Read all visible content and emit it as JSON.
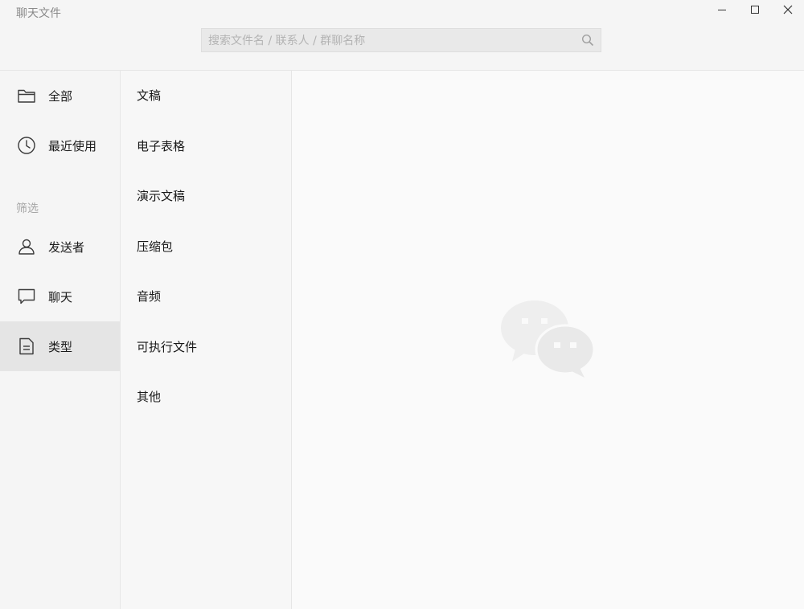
{
  "window": {
    "title": "聊天文件",
    "controls": [
      "minimize-icon",
      "maximize-icon",
      "close-icon"
    ]
  },
  "search": {
    "placeholder": "搜索文件名 / 联系人 / 群聊名称",
    "value": ""
  },
  "sidebar": {
    "top_items": [
      {
        "label": "全部",
        "icon": "folder-icon"
      },
      {
        "label": "最近使用",
        "icon": "clock-icon"
      }
    ],
    "filter_section_label": "筛选",
    "filter_items": [
      {
        "label": "发送者",
        "icon": "user-icon"
      },
      {
        "label": "聊天",
        "icon": "chat-bubble-icon"
      },
      {
        "label": "类型",
        "icon": "document-icon",
        "active": true
      }
    ]
  },
  "types": {
    "items": [
      "文稿",
      "电子表格",
      "演示文稿",
      "压缩包",
      "音频",
      "可执行文件",
      "其他"
    ]
  },
  "content": {
    "placeholder_icon": "wechat-logo-icon"
  },
  "colors": {
    "background": "#f5f5f5",
    "active_item": "#e5e5e5",
    "content_bg": "#fafafa",
    "icon": "#3a3a3a",
    "logo": "#eeeeee"
  }
}
